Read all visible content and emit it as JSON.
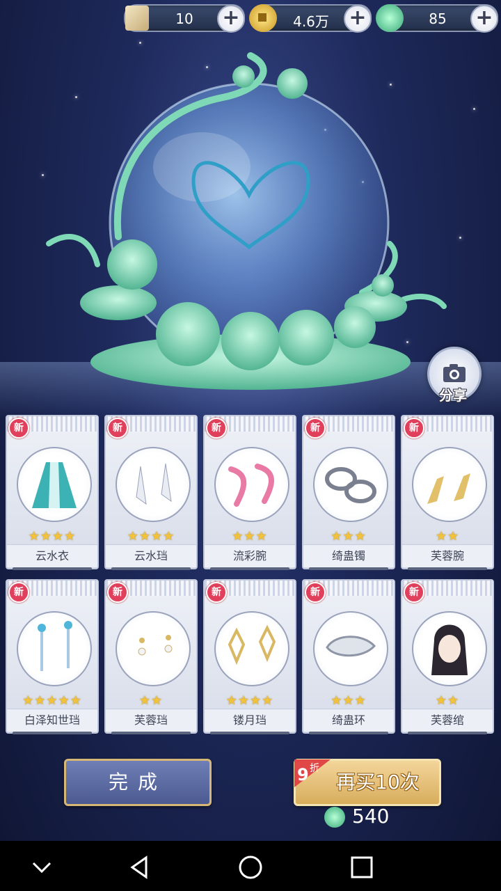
{
  "currency": {
    "tickets": "10",
    "coins": "4.6万",
    "jade": "85"
  },
  "share_label": "分享",
  "items": [
    {
      "name": "云水衣",
      "stars": "★★★★",
      "new": "新"
    },
    {
      "name": "云水珰",
      "stars": "★★★★",
      "new": "新"
    },
    {
      "name": "流彩腕",
      "stars": "★★★",
      "new": "新"
    },
    {
      "name": "绮蛊镯",
      "stars": "★★★",
      "new": "新"
    },
    {
      "name": "芙蓉腕",
      "stars": "★★",
      "new": "新"
    },
    {
      "name": "白泽知世珰",
      "stars": "★★★★★",
      "new": "新"
    },
    {
      "name": "芙蓉珰",
      "stars": "★★",
      "new": "新"
    },
    {
      "name": "镂月珰",
      "stars": "★★★★",
      "new": "新"
    },
    {
      "name": "绮蛊环",
      "stars": "★★★",
      "new": "新"
    },
    {
      "name": "芙蓉绾",
      "stars": "★★",
      "new": "新"
    }
  ],
  "buttons": {
    "done": "完成",
    "buy_again": "再买10次",
    "discount_number": "9",
    "discount_unit": "折",
    "cost": "540"
  },
  "colors": {
    "background": "#1e2a5c",
    "jade": "#7fd9b6",
    "star": "#f2c23a",
    "new_badge": "#e0405c"
  }
}
